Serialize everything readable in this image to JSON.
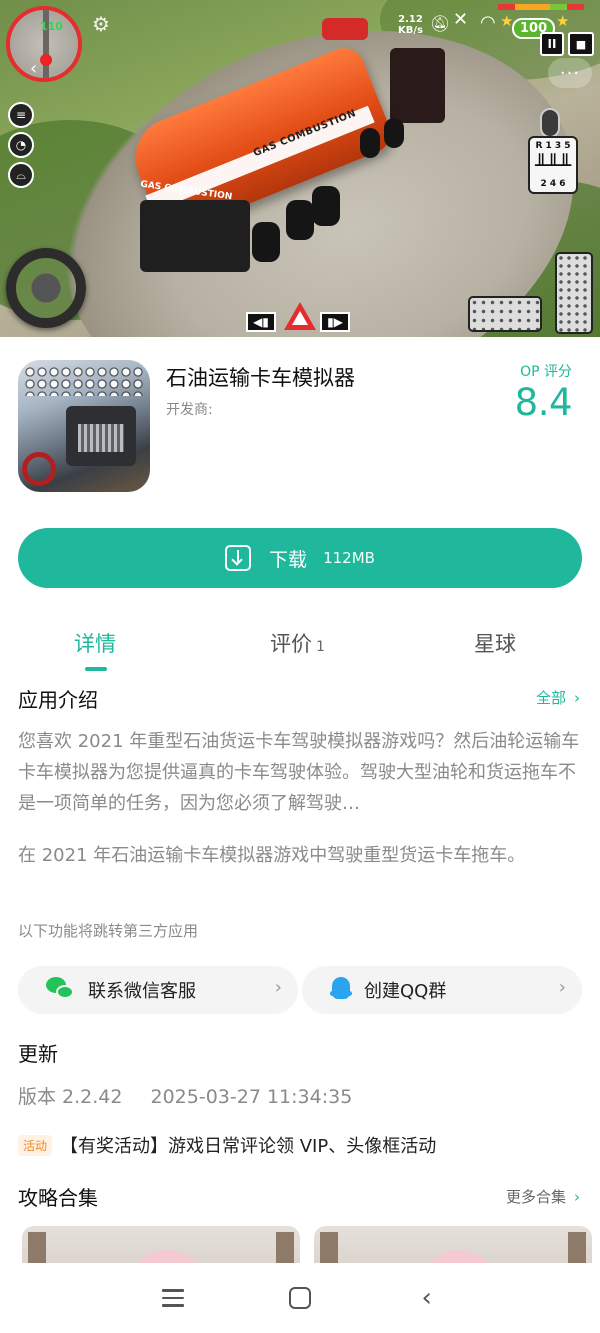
{
  "banner": {
    "minimap_number": "110",
    "speed_value": "2.12",
    "speed_unit": "KB/s",
    "score": "100",
    "pause_label": "II",
    "tank_label": "GAS COMBUSTION",
    "tank_label_rear": "GAS COMBUSTION",
    "gearbox_top": "R 1 3 5",
    "gearbox_bottom": "2 4 6",
    "health_colors": [
      "#e53935",
      "#f5a623",
      "#f5a623",
      "#7cc43c",
      "#e53935"
    ]
  },
  "app": {
    "title": "石油运输卡车模拟器",
    "developer_label": "开发商:",
    "rating_label": "OP 评分",
    "rating_value": "8.4"
  },
  "download": {
    "label": "下载",
    "size": "112MB"
  },
  "tabs": {
    "details": "详情",
    "reviews": "评价",
    "reviews_count": "1",
    "planet": "星球"
  },
  "intro": {
    "title": "应用介绍",
    "all_link": "全部",
    "paragraph1": "您喜欢 2021 年重型石油货运卡车驾驶模拟器游戏吗？然后油轮运输车卡车模拟器为您提供逼真的卡车驾驶体验。驾驶大型油轮和货运拖车不是一项简单的任务，因为您必须了解驾驶…",
    "paragraph2": "在 2021 年石油运输卡车模拟器游戏中驾驶重型货运卡车拖车。",
    "third_party_note": "以下功能将跳转第三方应用"
  },
  "contact": {
    "wechat_label": "联系微信客服",
    "qq_label": "创建QQ群"
  },
  "update": {
    "title": "更新",
    "version": "版本 2.2.42",
    "date": "2025-03-27 11:34:35"
  },
  "event": {
    "badge": "活动",
    "text": "【有奖活动】游戏日常评论领 VIP、头像框活动"
  },
  "guides": {
    "title": "攻略合集",
    "more_link": "更多合集"
  },
  "colors": {
    "accent": "#1fb89c",
    "event_badge_bg": "#fff1e4",
    "event_badge_text": "#f08a2c"
  }
}
